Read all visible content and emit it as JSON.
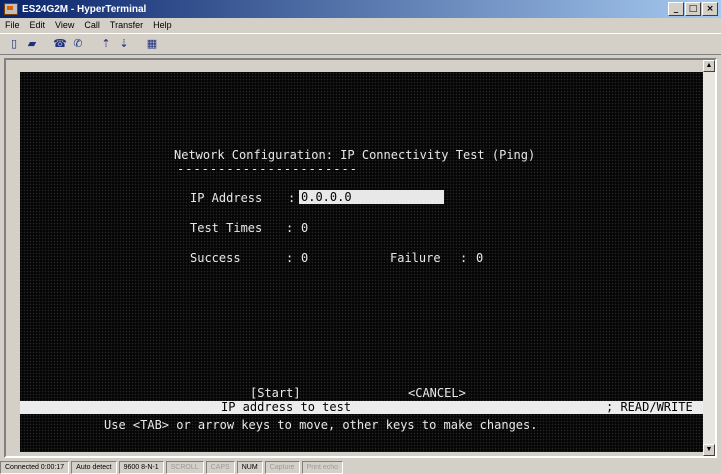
{
  "window": {
    "title": "ES24G2M - HyperTerminal"
  },
  "menu": {
    "items": [
      "File",
      "Edit",
      "View",
      "Call",
      "Transfer",
      "Help"
    ]
  },
  "toolbar": {
    "buttons": [
      {
        "icon": "new-icon"
      },
      {
        "icon": "open-icon"
      },
      {
        "icon": "connect-icon"
      },
      {
        "icon": "disconnect-icon"
      },
      {
        "icon": "send-icon"
      },
      {
        "icon": "receive-icon"
      },
      {
        "icon": "properties-icon"
      }
    ]
  },
  "terminal": {
    "heading": "Network Configuration: IP Connectivity Test (Ping)",
    "underline": "----------------------",
    "ip_label": "IP Address",
    "ip_sep": ":",
    "ip_value": "0.0.0.0",
    "test_times_label": "Test Times",
    "test_times_sep": ":",
    "test_times_value": "0",
    "success_label": "Success",
    "success_sep": ":",
    "success_value": "0",
    "failure_label": "Failure",
    "failure_sep": ":",
    "failure_value": "0",
    "start_button": "[Start]",
    "cancel_button": "<CANCEL>",
    "status_text": "IP address to test",
    "mode_text": "; READ/WRITE",
    "help_text": "Use <TAB> or arrow keys to move, other keys to make changes."
  },
  "statusbar": {
    "cells": [
      "Connected 0:00:17",
      "Auto detect",
      "9600 8-N-1",
      "SCROLL",
      "CAPS",
      "NUM",
      "Capture",
      "Print echo"
    ]
  }
}
